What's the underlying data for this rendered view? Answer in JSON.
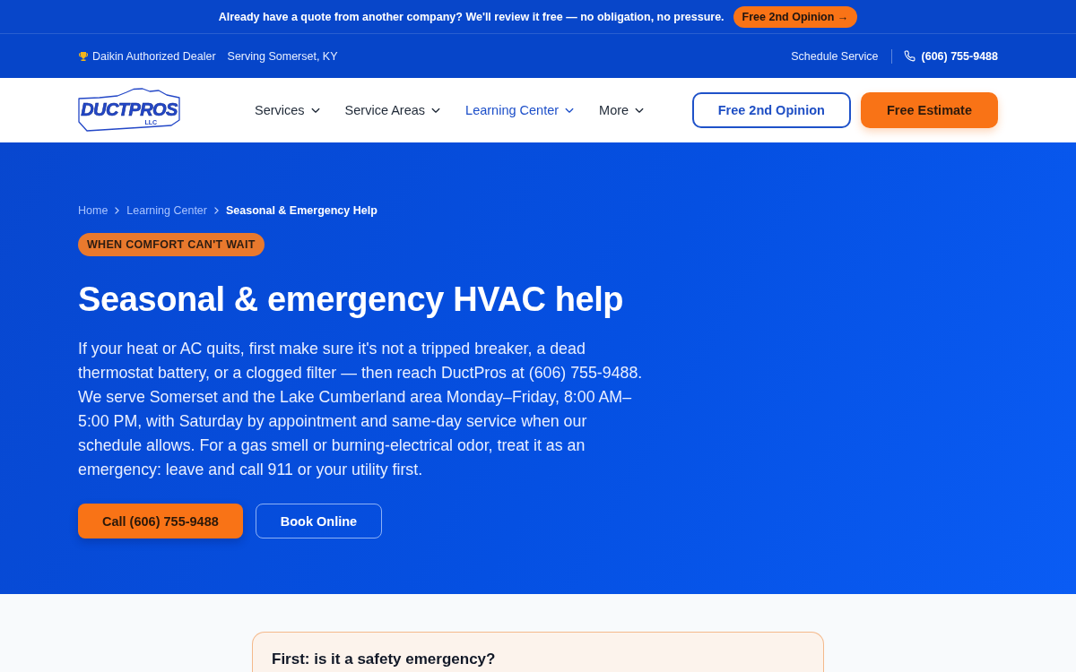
{
  "promo_bar": {
    "text": "Already have a quote from another company? We'll review it free — no obligation, no pressure.",
    "button": "Free 2nd Opinion →"
  },
  "info_bar": {
    "dealer": "Daikin Authorized Dealer",
    "area": "Serving Somerset, KY",
    "schedule_link": "Schedule Service",
    "phone": "(606) 755-9488"
  },
  "header": {
    "logo": {
      "wordmark": "DUCTPROS",
      "suffix": "LLC"
    },
    "nav": [
      {
        "label": "Services",
        "selected": false
      },
      {
        "label": "Service Areas",
        "selected": false
      },
      {
        "label": "Learning Center",
        "selected": true
      },
      {
        "label": "More",
        "selected": false
      }
    ],
    "buttons": [
      {
        "label": "Free 2nd Opinion",
        "kind": "outline"
      },
      {
        "label": "Free Estimate",
        "kind": "primary"
      }
    ]
  },
  "hero": {
    "breadcrumb": [
      {
        "label": "Home",
        "current": false
      },
      {
        "label": "Learning Center",
        "current": false
      },
      {
        "label": "Seasonal & Emergency Help",
        "current": true
      }
    ],
    "eyebrow": "WHEN COMFORT CAN'T WAIT",
    "title": "Seasonal & emergency HVAC help",
    "body": "If your heat or AC quits, first make sure it's not a tripped breaker, a dead thermostat battery, or a clogged filter — then reach DuctPros at (606) 755-9488. We serve Somerset and the Lake Cumberland area Monday–Friday, 8:00 AM–5:00 PM, with Saturday by appointment and same-day service when our schedule allows. For a gas smell or burning-electrical odor, treat it as an emergency: leave and call 911 or your utility first.",
    "buttons": [
      {
        "label": "Call (606) 755-9488",
        "kind": "primary"
      },
      {
        "label": "Book Online",
        "kind": "outline"
      }
    ]
  },
  "safety_card": {
    "title": "First: is it a safety emergency?"
  }
}
